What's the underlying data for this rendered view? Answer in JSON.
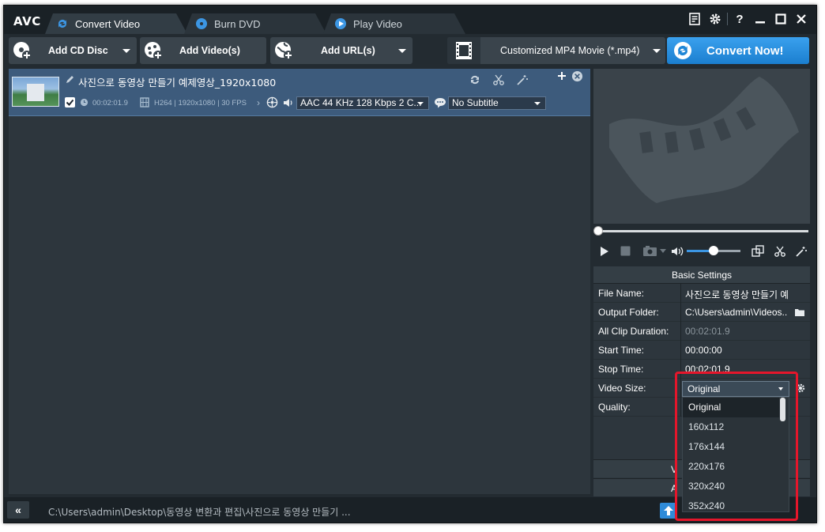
{
  "app": {
    "logo": "AVC"
  },
  "tabs": [
    {
      "label": "Convert Video",
      "icon": "convert-icon",
      "active": true
    },
    {
      "label": "Burn DVD",
      "icon": "disc-icon",
      "active": false
    },
    {
      "label": "Play Video",
      "icon": "play-circle-icon",
      "active": false
    }
  ],
  "window_controls": [
    "notes-icon",
    "gear-icon",
    "help-icon",
    "minimize-icon",
    "maximize-icon",
    "close-icon"
  ],
  "help_label": "?",
  "toolbar": {
    "add_cd": "Add CD Disc",
    "add_videos": "Add Video(s)",
    "add_url": "Add URL(s)",
    "profile": "Customized MP4 Movie (*.mp4)",
    "convert": "Convert Now!"
  },
  "file_item": {
    "name": "사진으로 동영상 만들기 예제영상_1920x1080",
    "checked": true,
    "duration": "00:02:01.9",
    "video_info": "H264 | 1920x1080 | 30 FPS",
    "audio": "AAC 44 KHz 128 Kbps 2 C...",
    "subtitle": "No Subtitle"
  },
  "player": {
    "seek_fraction": 0.0,
    "volume_fraction": 0.5
  },
  "settings": {
    "header": "Basic Settings",
    "rows": [
      {
        "label": "File Name:",
        "value": "사진으로 동영상 만들기 예..."
      },
      {
        "label": "Output Folder:",
        "value": "C:\\Users\\admin\\Videos..."
      },
      {
        "label": "All Clip Duration:",
        "value": "00:02:01.9"
      },
      {
        "label": "Start Time:",
        "value": "00:00:00"
      },
      {
        "label": "Stop Time:",
        "value": "00:02:01.9"
      },
      {
        "label": "Video Size:",
        "value": ""
      },
      {
        "label": "Quality:",
        "value": ""
      }
    ],
    "section_1": "V",
    "section_2": "A"
  },
  "video_size_dropdown": {
    "selected": "Original",
    "options": [
      "Original",
      "160x112",
      "176x144",
      "220x176",
      "320x240",
      "352x240"
    ],
    "highlight_color": "#e5162b"
  },
  "status": {
    "collapse": "«",
    "path": "C:\\Users\\admin\\Desktop\\동영상 변환과 편집\\사진으로 동영상 만들기 ..."
  },
  "colors": {
    "accent": "#2f8bd8",
    "selected_item": "#3d5b7c"
  }
}
